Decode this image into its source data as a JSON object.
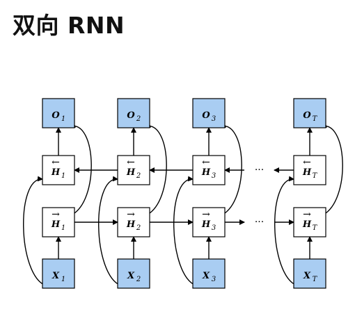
{
  "slide": {
    "title": "双向 RNN"
  },
  "diagram": {
    "columns": [
      {
        "id": "1",
        "output": {
          "symbol": "O",
          "sub": "1"
        },
        "hidden_backward": {
          "symbol": "H",
          "sub": "1",
          "arrow": "←"
        },
        "hidden_forward": {
          "symbol": "H",
          "sub": "1",
          "arrow": "→"
        },
        "input": {
          "symbol": "X",
          "sub": "1"
        }
      },
      {
        "id": "2",
        "output": {
          "symbol": "O",
          "sub": "2"
        },
        "hidden_backward": {
          "symbol": "H",
          "sub": "2",
          "arrow": "←"
        },
        "hidden_forward": {
          "symbol": "H",
          "sub": "2",
          "arrow": "→"
        },
        "input": {
          "symbol": "X",
          "sub": "2"
        }
      },
      {
        "id": "3",
        "output": {
          "symbol": "O",
          "sub": "3"
        },
        "hidden_backward": {
          "symbol": "H",
          "sub": "3",
          "arrow": "←"
        },
        "hidden_forward": {
          "symbol": "H",
          "sub": "3",
          "arrow": "→"
        },
        "input": {
          "symbol": "X",
          "sub": "3"
        }
      },
      {
        "id": "T",
        "output": {
          "symbol": "O",
          "sub": "T"
        },
        "hidden_backward": {
          "symbol": "H",
          "sub": "T",
          "arrow": "←"
        },
        "hidden_forward": {
          "symbol": "H",
          "sub": "T",
          "arrow": "→"
        },
        "input": {
          "symbol": "X",
          "sub": "T"
        }
      }
    ],
    "ellipsis": "···",
    "colors": {
      "io_fill": "#a9cdf2",
      "hidden_fill": "#ffffff",
      "stroke": "#000000"
    }
  }
}
